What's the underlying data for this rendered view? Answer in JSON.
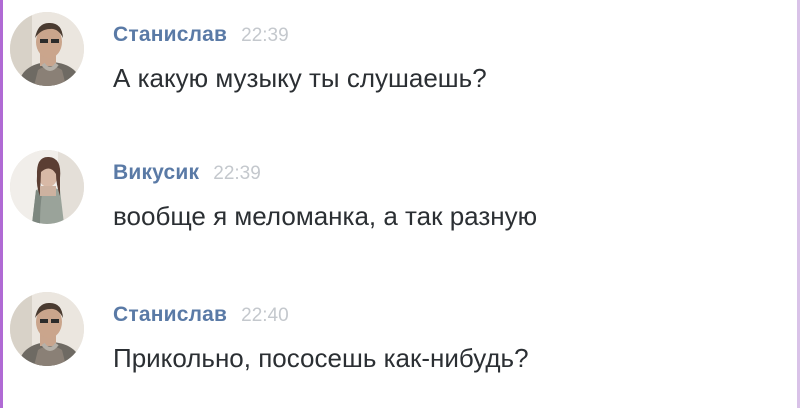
{
  "messages": [
    {
      "author": "Станислав",
      "time": "22:39",
      "text": "А какую музыку ты слушаешь?"
    },
    {
      "author": "Викусик",
      "time": "22:39",
      "text": "вообще я меломанка, а так разную"
    },
    {
      "author": "Станислав",
      "time": "22:40",
      "text": "Прикольно, пососешь как-нибудь?"
    }
  ],
  "colors": {
    "author": "#5a7aa6",
    "time": "#c4c8cd",
    "text": "#2b2f33",
    "frame_accent": "#b06ad4"
  }
}
